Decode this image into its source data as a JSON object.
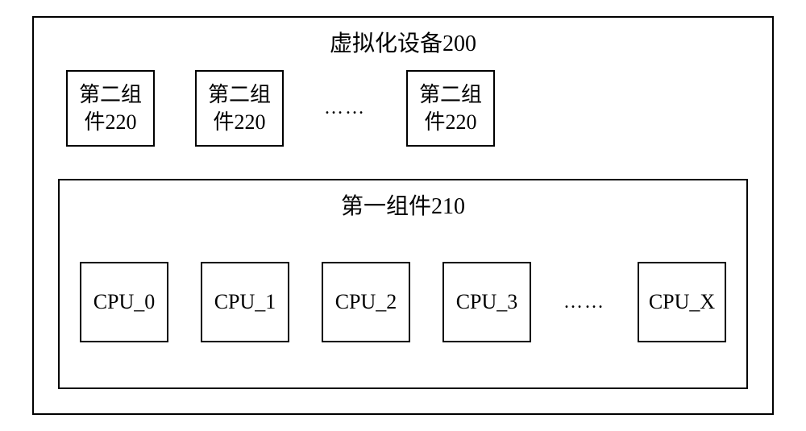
{
  "outer": {
    "title": "虚拟化设备200"
  },
  "topComponents": {
    "items": [
      {
        "label": "第二组件220"
      },
      {
        "label": "第二组件220"
      },
      {
        "label": "第二组件220"
      }
    ],
    "ellipsis": "……"
  },
  "inner": {
    "title": "第一组件210"
  },
  "cpus": {
    "items": [
      {
        "label": "CPU_0"
      },
      {
        "label": "CPU_1"
      },
      {
        "label": "CPU_2"
      },
      {
        "label": "CPU_3"
      },
      {
        "label": "CPU_X"
      }
    ],
    "ellipsis": "……"
  }
}
